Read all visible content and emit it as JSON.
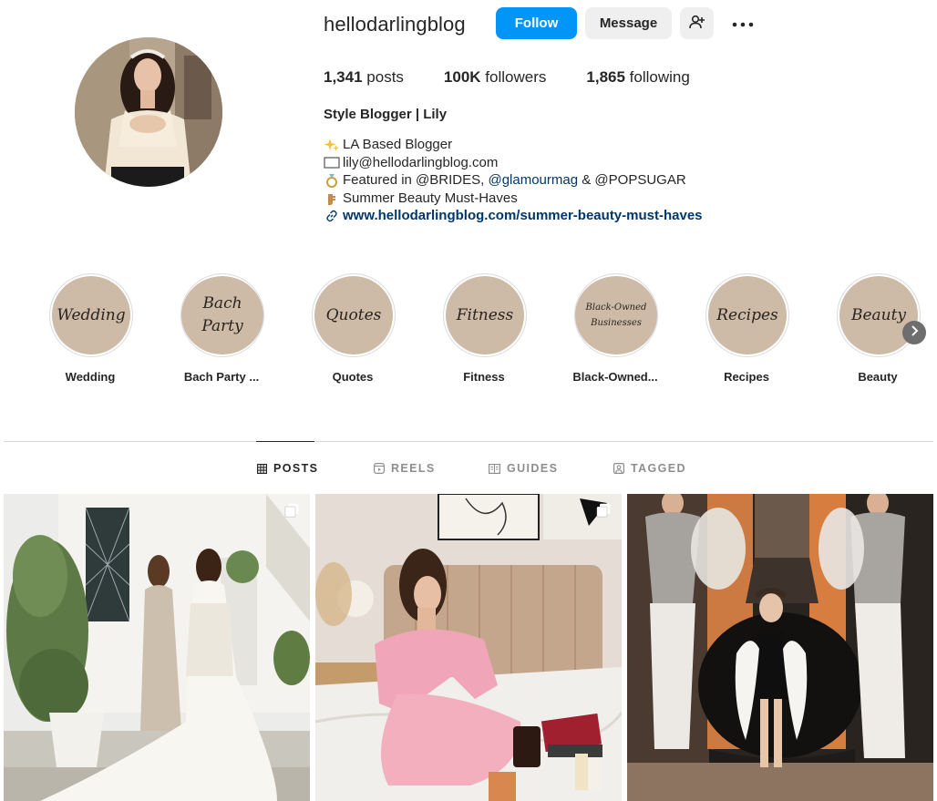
{
  "profile": {
    "username": "hellodarlingblog",
    "follow_label": "Follow",
    "message_label": "Message",
    "add_user_icon": "add-user-icon",
    "more_icon": "more-options-icon",
    "stats": {
      "posts_count": "1,341",
      "posts_label": "posts",
      "followers_count": "100K",
      "followers_label": "followers",
      "following_count": "1,865",
      "following_label": "following"
    },
    "full_name": "Style Blogger | Lily",
    "bio": {
      "line1": "LA Based Blogger",
      "line2": "lily@hellodarlingblog.com",
      "line3_prefix": "Featured in @BRIDES, ",
      "line3_mention": "@glamourmag",
      "line3_suffix": " & @POPSUGAR",
      "line4": "Summer Beauty Must-Haves",
      "link": "www.hellodarlingblog.com/summer-beauty-must-haves"
    }
  },
  "highlights": [
    {
      "cover": "Wedding",
      "label": "Wedding"
    },
    {
      "cover": "Bach Party",
      "label": "Bach Party ..."
    },
    {
      "cover": "Quotes",
      "label": "Quotes"
    },
    {
      "cover": "Fitness",
      "label": "Fitness"
    },
    {
      "cover": "Black-Owned Businesses",
      "label": "Black-Owned..."
    },
    {
      "cover": "Recipes",
      "label": "Recipes"
    },
    {
      "cover": "Beauty",
      "label": "Beauty"
    }
  ],
  "tabs": {
    "posts": "POSTS",
    "reels": "REELS",
    "guides": "GUIDES",
    "tagged": "TAGGED"
  },
  "colors": {
    "accent": "#0095f6",
    "highlight_bg": "#cdbba8",
    "link": "#00376b"
  }
}
